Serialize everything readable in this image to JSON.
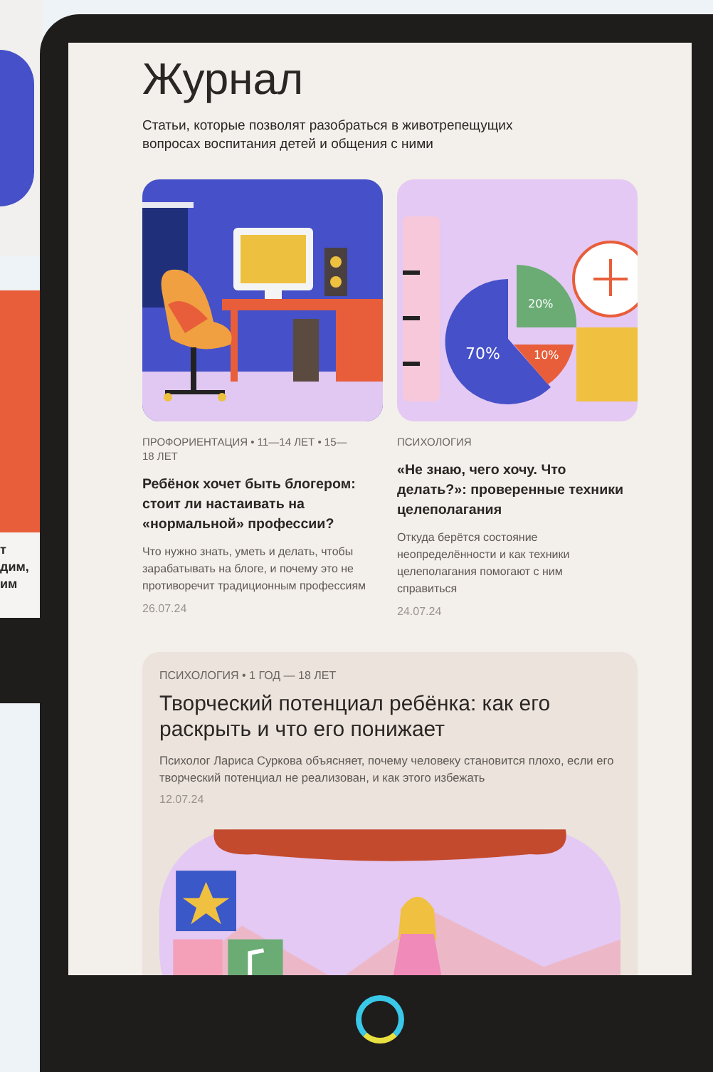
{
  "background_card": {
    "lines": [
      "т",
      "дим,",
      "им"
    ]
  },
  "journal": {
    "title": "Журнал",
    "subtitle": "Статьи, которые позволят разобраться в животрепещущих вопросах воспитания детей и общения с ними",
    "articles": [
      {
        "kind": "small",
        "image": {
          "kind": "office"
        },
        "tags": "ПРОФОРИЕНТАЦИЯ • 11—14 ЛЕТ • 15—18 ЛЕТ",
        "title": "Ребёнок хочет быть блогером: стоит ли настаивать на «нормальной» профессии?",
        "description": "Что нужно знать, уметь и делать, чтобы зарабатывать на блоге, и почему это не противоречит традиционным профессиям",
        "date": "26.07.24"
      },
      {
        "kind": "small",
        "image": {
          "kind": "chart",
          "labels": [
            "70%",
            "20%",
            "10%"
          ]
        },
        "tags": "ПСИХОЛОГИЯ",
        "title": "«Не знаю, чего хочу. Что делать?»: проверенные техники целеполагания",
        "description": "Откуда берётся состояние неопределённости и как техники целеполагания помогают с ним справиться",
        "date": "24.07.24"
      },
      {
        "kind": "wide",
        "image": {
          "kind": "stage"
        },
        "tags": "ПСИХОЛОГИЯ • 1 ГОД — 18 ЛЕТ",
        "title": "Творческий потенциал ребёнка: как его раскрыть и что его понижает",
        "description": "Психолог Лариса Суркова объясняет, почему человеку становится плохо, если его творческий потенциал не реализован, и как этого избежать",
        "date": "12.07.24"
      }
    ]
  }
}
